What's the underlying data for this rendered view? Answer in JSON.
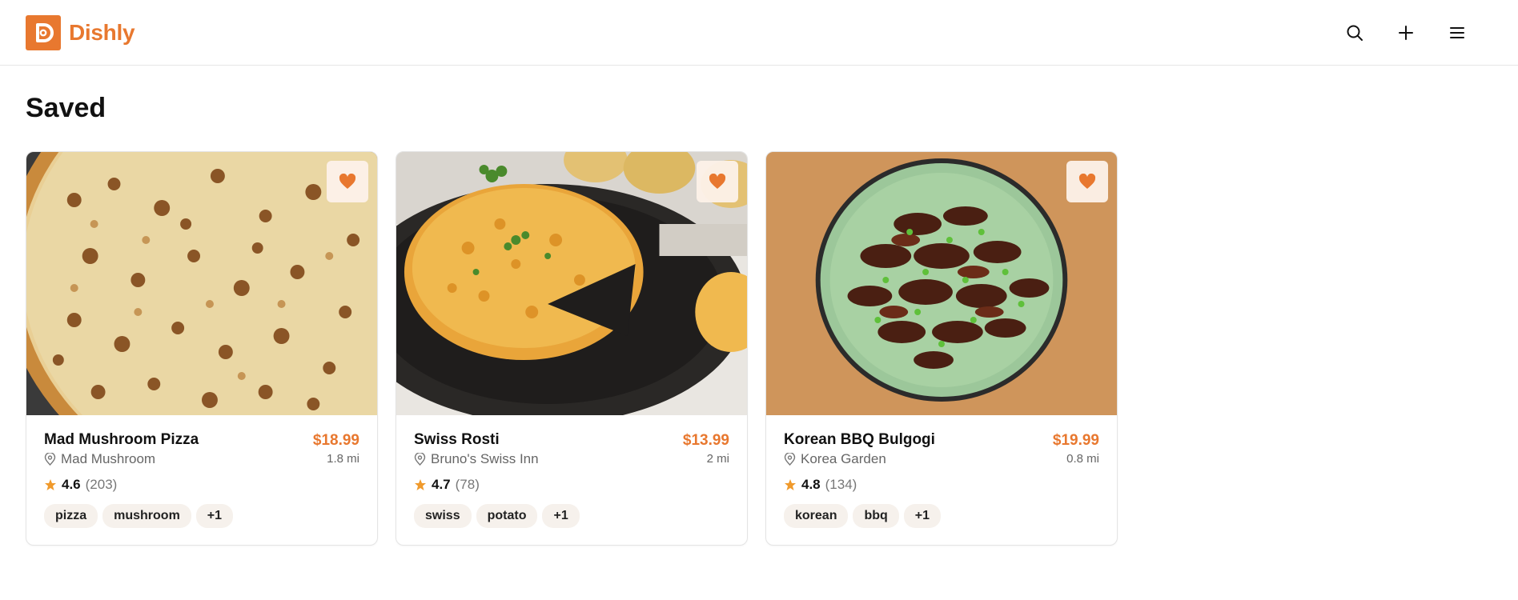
{
  "header": {
    "brand_name": "Dishly",
    "accent_color": "#e8782f",
    "actions": [
      {
        "icon": "search-icon"
      },
      {
        "icon": "plus-icon"
      },
      {
        "icon": "menu-icon"
      }
    ]
  },
  "page": {
    "title": "Saved"
  },
  "cards": [
    {
      "name": "Mad Mushroom Pizza",
      "restaurant": "Mad Mushroom",
      "price": "$18.99",
      "distance": "1.8 mi",
      "rating": "4.6",
      "reviews": "(203)",
      "tags": [
        "pizza",
        "mushroom",
        "+1"
      ],
      "image": "pizza-photo",
      "favorited": true
    },
    {
      "name": "Swiss Rosti",
      "restaurant": "Bruno's Swiss Inn",
      "price": "$13.99",
      "distance": "2 mi",
      "rating": "4.7",
      "reviews": "(78)",
      "tags": [
        "swiss",
        "potato",
        "+1"
      ],
      "image": "rosti-photo",
      "favorited": true
    },
    {
      "name": "Korean BBQ Bulgogi",
      "restaurant": "Korea Garden",
      "price": "$19.99",
      "distance": "0.8 mi",
      "rating": "4.8",
      "reviews": "(134)",
      "tags": [
        "korean",
        "bbq",
        "+1"
      ],
      "image": "bulgogi-photo",
      "favorited": true
    }
  ]
}
